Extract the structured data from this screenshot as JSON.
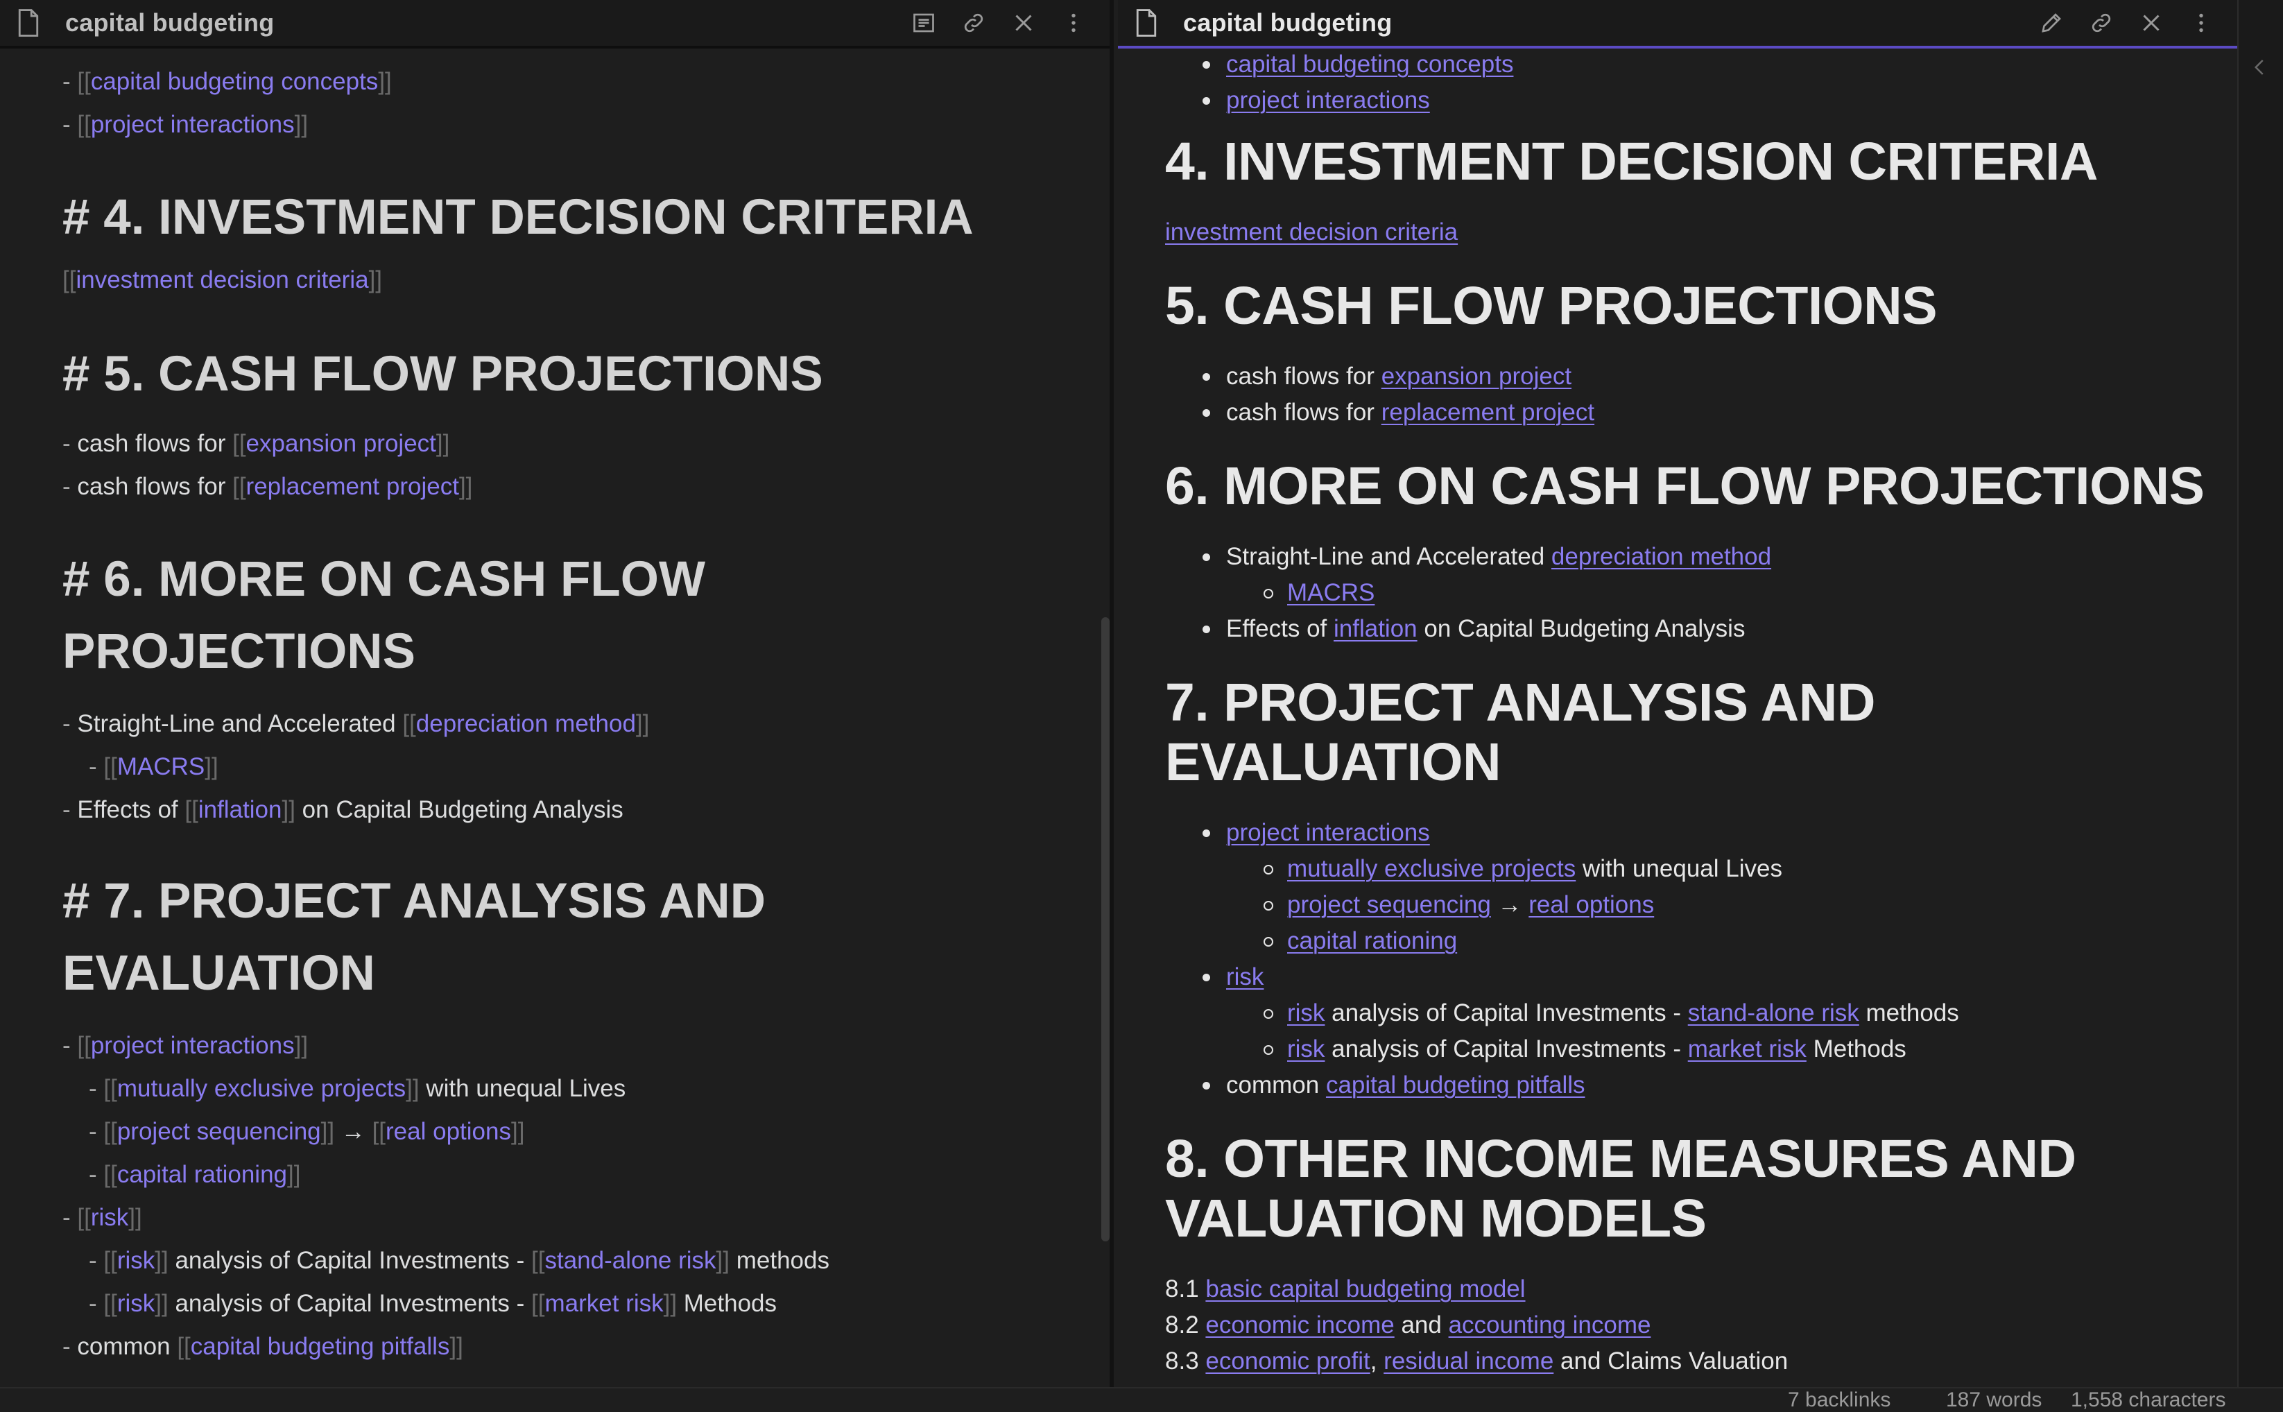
{
  "left_pane": {
    "title": "capital budgeting",
    "icons": [
      "document-icon",
      "reading-view-icon",
      "link-icon",
      "close-icon",
      "more-options-icon"
    ]
  },
  "right_pane": {
    "title": "capital budgeting",
    "icons": [
      "document-icon",
      "edit-icon",
      "link-icon",
      "close-icon",
      "more-options-icon"
    ]
  },
  "source": {
    "l_concepts": "capital budgeting concepts",
    "l_interactions_top": "project interactions",
    "h4": "# 4. INVESTMENT DECISION CRITERIA",
    "l_idc": "investment decision criteria",
    "h5": "# 5. CASH FLOW PROJECTIONS",
    "cf_prefix": "cash flows for ",
    "l_expansion": "expansion project",
    "l_replacement": "replacement project",
    "h6_a": "# 6. MORE ON CASH FLOW",
    "h6_b": "PROJECTIONS",
    "sl_prefix": "Straight-Line and Accelerated ",
    "l_depr": "depreciation method",
    "l_macrs": "MACRS",
    "eff_prefix": "Effects of ",
    "l_inflation": "inflation",
    "eff_suffix": " on Capital Budgeting Analysis",
    "h7_a": "# 7. PROJECT ANALYSIS AND",
    "h7_b": "EVALUATION",
    "l_interactions": "project interactions",
    "l_mutual": "mutually exclusive projects",
    "mutual_suffix": " with unequal Lives",
    "l_sequencing": "project sequencing",
    "arrow": " → ",
    "l_real": "real options",
    "l_rationing": "capital rationing",
    "l_risk": "risk",
    "risk_mid": " analysis of Capital Investments - ",
    "l_standalone": "stand-alone risk",
    "sa_suffix": " methods",
    "l_market": "market risk",
    "mk_suffix": " Methods",
    "common_prefix": "common ",
    "l_pitfalls": "capital budgeting pitfalls"
  },
  "reading": {
    "l_concepts": "capital budgeting concepts",
    "l_interactions_top": "project interactions",
    "h4": "4. INVESTMENT DECISION CRITERIA",
    "l_idc": "investment decision criteria",
    "h5": "5. CASH FLOW PROJECTIONS",
    "cf_prefix": "cash flows for ",
    "l_expansion": "expansion project",
    "l_replacement": "replacement project",
    "h6": "6. MORE ON CASH FLOW PROJECTIONS",
    "sl_prefix": "Straight-Line and Accelerated ",
    "l_depr": "depreciation method",
    "l_macrs": "MACRS",
    "eff_prefix": "Effects of ",
    "l_inflation": "inflation",
    "eff_suffix": " on Capital Budgeting Analysis",
    "h7_a": "7. PROJECT ANALYSIS AND",
    "h7_b": "EVALUATION",
    "l_interactions": "project interactions",
    "l_mutual": "mutually exclusive projects",
    "mutual_suffix": " with unequal Lives",
    "l_sequencing": "project sequencing",
    "arrow": " → ",
    "l_real": "real options",
    "l_rationing": "capital rationing",
    "l_risk": "risk",
    "risk_mid": " analysis of Capital Investments - ",
    "l_standalone": "stand-alone risk",
    "sa_suffix": " methods",
    "l_market": "market risk",
    "mk_suffix": " Methods",
    "common_prefix": "common ",
    "l_pitfalls": "capital budgeting pitfalls",
    "h8_a": "8. OTHER INCOME MEASURES AND",
    "h8_b": "VALUATION MODELS",
    "n81": "8.1 ",
    "l_basic": "basic capital budgeting model",
    "n82": "8.2 ",
    "l_econ_income": "economic income",
    "and": " and ",
    "l_acct_income": "accounting income",
    "n83": "8.3 ",
    "l_econ_profit": "economic profit",
    "comma": ", ",
    "l_residual": "residual income",
    "claims_suffix": " and Claims Valuation"
  },
  "status": {
    "backlinks": "7 backlinks",
    "words": "187 words",
    "characters": "1,558 characters"
  },
  "colors": {
    "background": "#1e1e1e",
    "header": "#1a1a1a",
    "link": "#8a7cf0",
    "active_tab_border": "#5b4bc4",
    "text": "#dcddde"
  }
}
